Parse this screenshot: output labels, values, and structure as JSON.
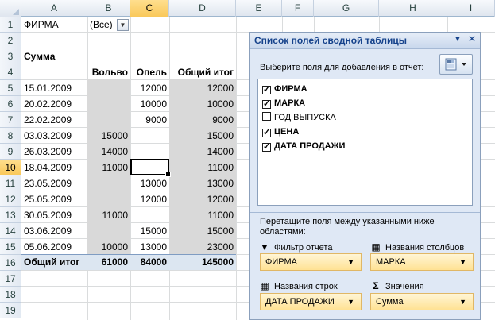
{
  "columns": [
    "A",
    "B",
    "C",
    "D",
    "E",
    "F",
    "G",
    "H",
    "I"
  ],
  "rows": [
    "1",
    "2",
    "3",
    "4",
    "5",
    "6",
    "7",
    "8",
    "9",
    "10",
    "11",
    "12",
    "13",
    "14",
    "15",
    "16",
    "17",
    "18",
    "19"
  ],
  "selected_column": "C",
  "selected_row": "10",
  "filter": {
    "label": "ФИРМА",
    "value": "(Все)"
  },
  "pivot": {
    "values_label": "Сумма",
    "headers": [
      "Вольво",
      "Опель",
      "Общий итог"
    ],
    "rows": [
      {
        "date": "15.01.2009",
        "volvo": "",
        "opel": "12000",
        "total": "12000"
      },
      {
        "date": "20.02.2009",
        "volvo": "",
        "opel": "10000",
        "total": "10000"
      },
      {
        "date": "22.02.2009",
        "volvo": "",
        "opel": "9000",
        "total": "9000"
      },
      {
        "date": "03.03.2009",
        "volvo": "15000",
        "opel": "",
        "total": "15000"
      },
      {
        "date": "26.03.2009",
        "volvo": "14000",
        "opel": "",
        "total": "14000"
      },
      {
        "date": "18.04.2009",
        "volvo": "11000",
        "opel": "",
        "total": "11000"
      },
      {
        "date": "23.05.2009",
        "volvo": "",
        "opel": "13000",
        "total": "13000"
      },
      {
        "date": "25.05.2009",
        "volvo": "",
        "opel": "12000",
        "total": "12000"
      },
      {
        "date": "30.05.2009",
        "volvo": "11000",
        "opel": "",
        "total": "11000"
      },
      {
        "date": "03.06.2009",
        "volvo": "",
        "opel": "15000",
        "total": "15000"
      },
      {
        "date": "05.06.2009",
        "volvo": "10000",
        "opel": "13000",
        "total": "23000"
      }
    ],
    "grand_total": {
      "label": "Общий итог",
      "volvo": "61000",
      "opel": "84000",
      "total": "145000"
    }
  },
  "pane": {
    "title": "Список полей сводной таблицы",
    "hint": "Выберите поля для добавления в отчет:",
    "fields": [
      {
        "name": "ФИРМА",
        "checked": true
      },
      {
        "name": "МАРКА",
        "checked": true
      },
      {
        "name": "ГОД ВЫПУСКА",
        "checked": false
      },
      {
        "name": "ЦЕНА",
        "checked": true
      },
      {
        "name": "ДАТА ПРОДАЖИ",
        "checked": true
      }
    ],
    "drag_hint": "Перетащите поля между указанными ниже областями:",
    "areas": {
      "report_filter": {
        "label": "Фильтр отчета",
        "value": "ФИРМА"
      },
      "column_labels": {
        "label": "Названия столбцов",
        "value": "МАРКА"
      },
      "row_labels": {
        "label": "Названия строк",
        "value": "ДАТА ПРОДАЖИ"
      },
      "values": {
        "label": "Значения",
        "value": "Сумма"
      }
    }
  }
}
